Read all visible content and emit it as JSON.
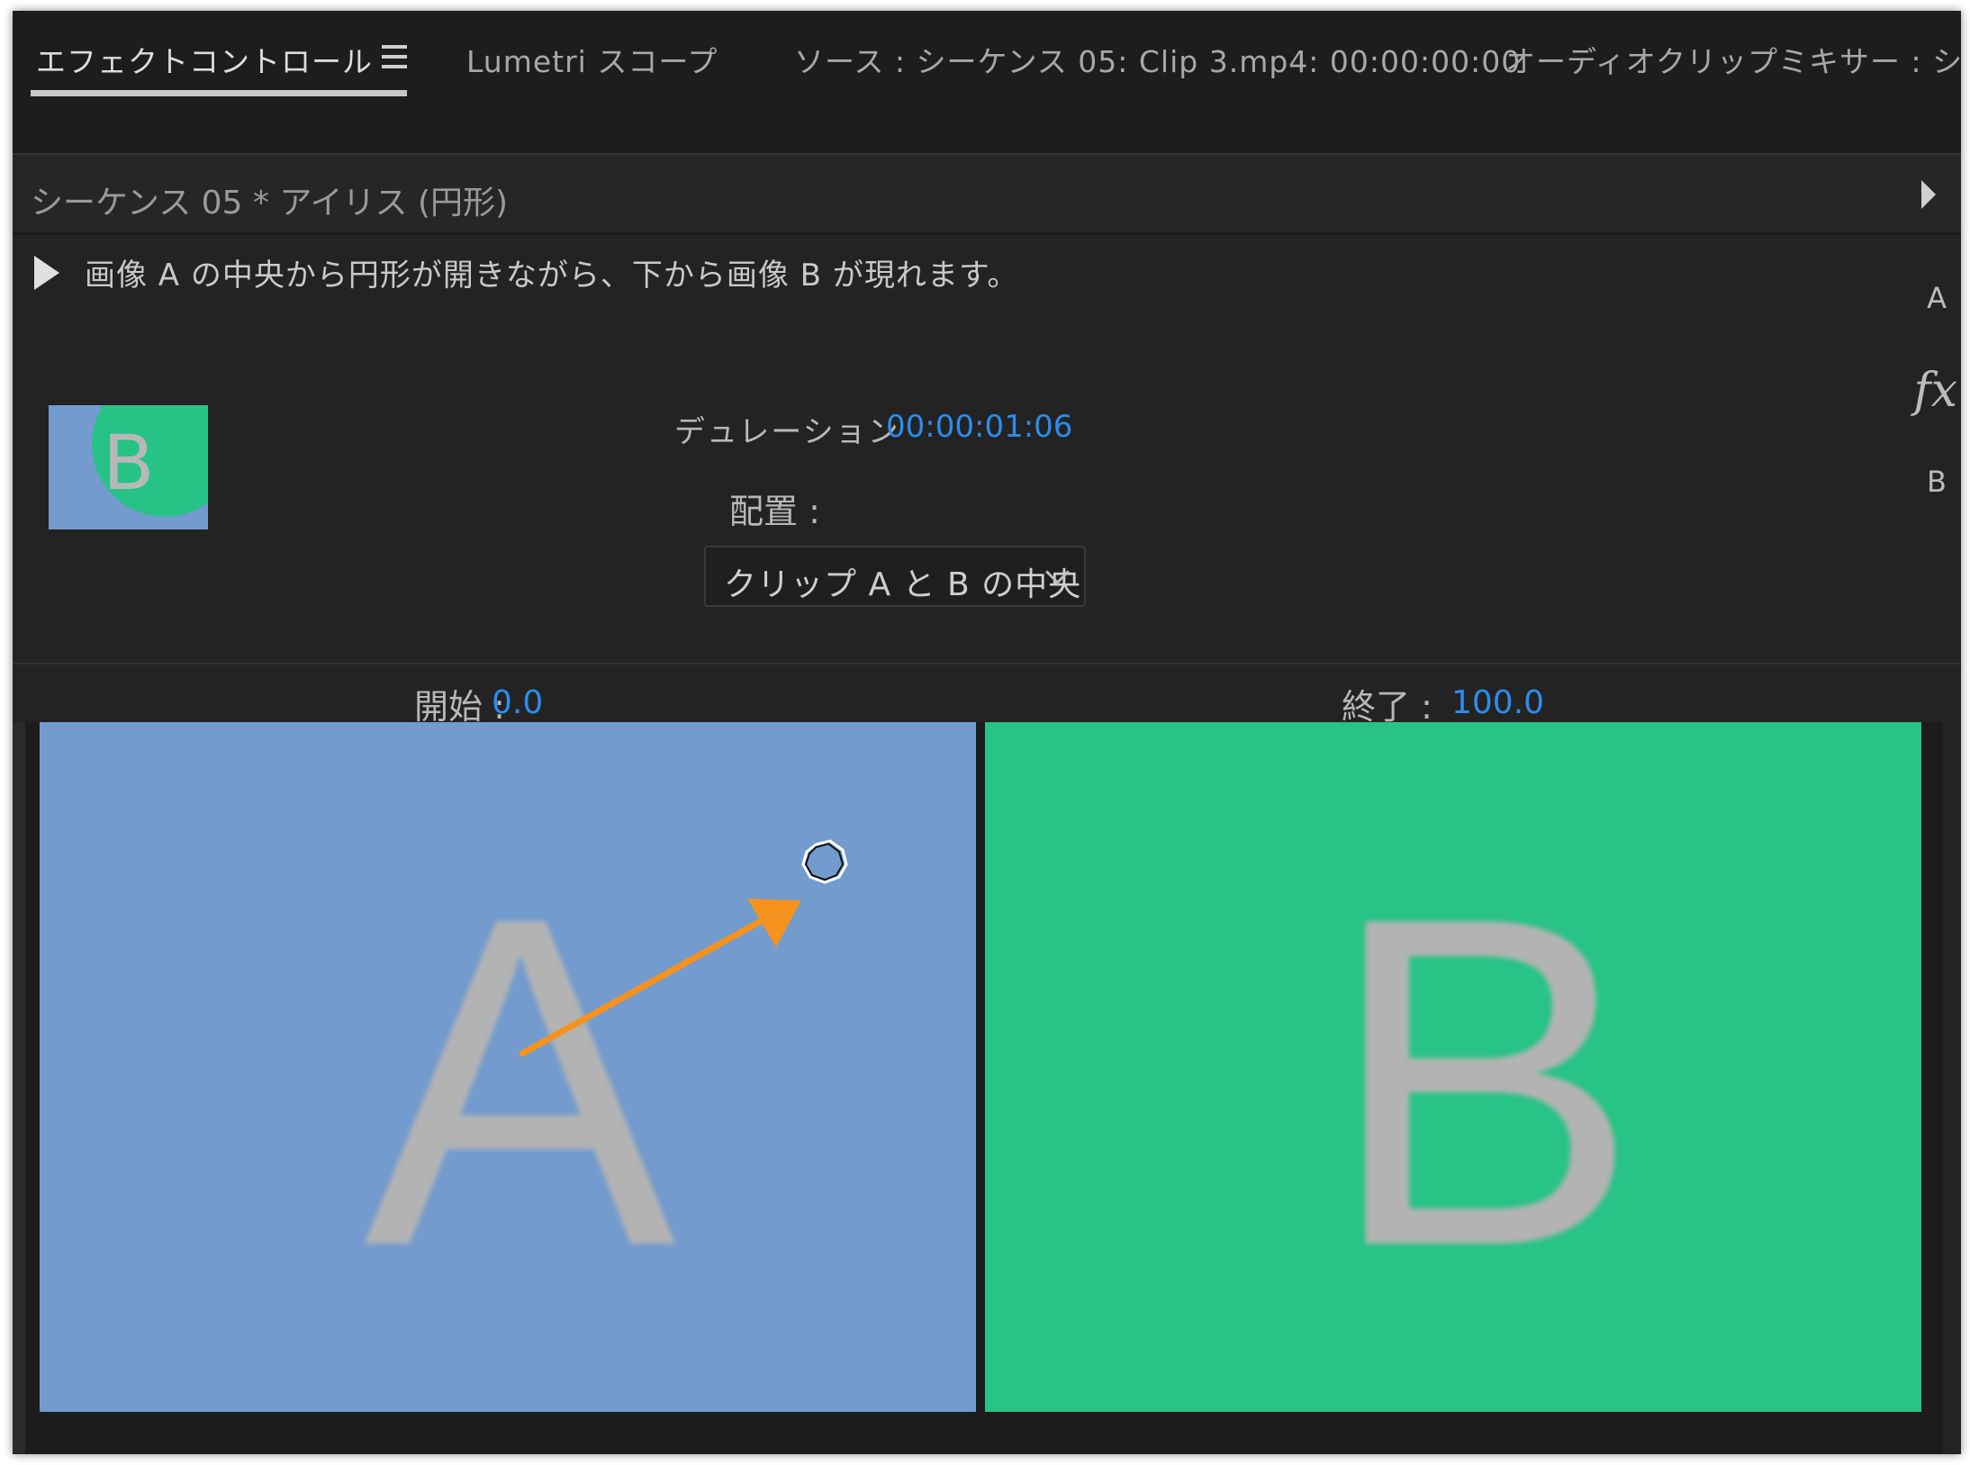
{
  "tabs": [
    {
      "label": "エフェクトコントロール",
      "active": true
    },
    {
      "label": "Lumetri スコープ"
    },
    {
      "label": "ソース : シーケンス 05: Clip 3.mp4: 00:00:00:00"
    },
    {
      "label": "オーディオクリップミキサー : シー"
    }
  ],
  "sequence": {
    "title": "シーケンス 05 * アイリス (円形)"
  },
  "description": "画像 A の中央から円形が開きながら、下から画像 B が現れます。",
  "side_labels": {
    "a": "A",
    "fx": "fx",
    "b": "B"
  },
  "thumbnail": {
    "letter": "B"
  },
  "duration": {
    "label": "デュレーション",
    "value": "00:00:01:06"
  },
  "alignment": {
    "label": "配置 :",
    "selected": "クリップ A と B の中央"
  },
  "start": {
    "label": "開始 :",
    "value": "0.0"
  },
  "end": {
    "label": "終了 :",
    "value": "100.0"
  },
  "clips": {
    "a_letter": "A",
    "b_letter": "B"
  },
  "colors": {
    "clip_a": "#739bce",
    "clip_b": "#28c386",
    "accent_value": "#2d8ceb",
    "arrow": "#f5921e"
  },
  "icons": [
    "menu-icon",
    "play-icon",
    "chevron-down-icon",
    "center-handle-icon",
    "arrow-icon"
  ]
}
